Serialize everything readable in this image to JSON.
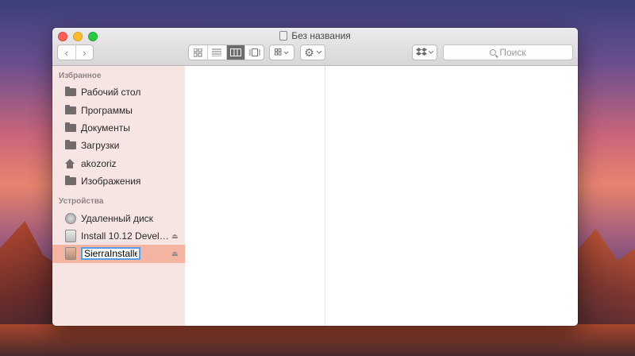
{
  "window": {
    "title": "Без названия"
  },
  "toolbar": {
    "back": "‹",
    "forward": "›",
    "search_placeholder": "Поиск"
  },
  "sidebar": {
    "favorites_header": "Избранное",
    "favorites": [
      {
        "label": "Рабочий стол",
        "icon": "folder-icon"
      },
      {
        "label": "Программы",
        "icon": "folder-icon"
      },
      {
        "label": "Документы",
        "icon": "folder-icon"
      },
      {
        "label": "Загрузки",
        "icon": "folder-icon"
      },
      {
        "label": "akozoriz",
        "icon": "home-icon"
      },
      {
        "label": "Изображения",
        "icon": "folder-icon"
      }
    ],
    "devices_header": "Устройства",
    "devices": [
      {
        "label": "Удаленный диск",
        "icon": "remote-disc-icon"
      },
      {
        "label": "Install 10.12 Devel…",
        "icon": "drive-icon",
        "eject": "⏏"
      },
      {
        "label": "SierraInstaller",
        "icon": "drive-icon",
        "eject": "⏏",
        "editing": true
      }
    ]
  },
  "colors": {
    "selection": "#f4b4a2",
    "sidebar_bg": "#f6e4e2",
    "active_view": "#6b6b6b"
  }
}
